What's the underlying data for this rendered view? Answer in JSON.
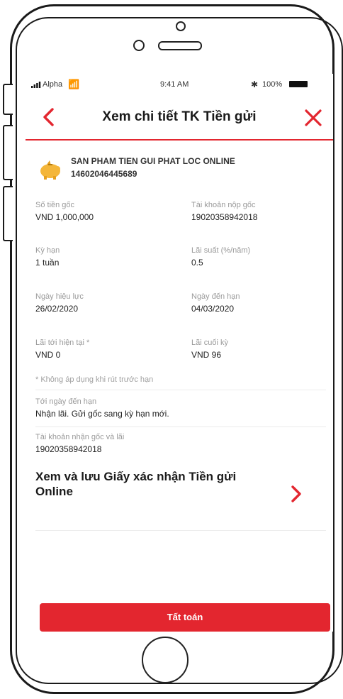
{
  "status_bar": {
    "carrier": "Alpha",
    "time": "9:41 AM",
    "battery": "100%"
  },
  "nav": {
    "title": "Xem chi tiết TK Tiền gửi"
  },
  "product": {
    "name": "SAN PHAM TIEN GUI PHAT LOC ONLINE",
    "number": "14602046445689"
  },
  "details": {
    "principal": {
      "label": "Số tiền gốc",
      "value": "VND 1,000,000"
    },
    "deposit_account": {
      "label": "Tài khoản nộp gốc",
      "value": "19020358942018"
    },
    "term": {
      "label": "Kỳ hạn",
      "value": "1 tuần"
    },
    "rate": {
      "label": "Lãi suất (%/năm)",
      "value": "0.5"
    },
    "effective_date": {
      "label": "Ngày hiệu lực",
      "value": "26/02/2020"
    },
    "maturity_date": {
      "label": "Ngày đến hạn",
      "value": "04/03/2020"
    },
    "current_interest": {
      "label": "Lãi tới hiện tại *",
      "value": "VND 0"
    },
    "final_interest": {
      "label": "Lãi cuối kỳ",
      "value": "VND 96"
    },
    "note": "* Không áp dụng khi rút trước hạn",
    "on_maturity": {
      "label": "Tới ngày đến hạn",
      "value": "Nhận lãi. Gửi gốc sang kỳ hạn mới."
    },
    "receiving_account": {
      "label": "Tài khoản nhận gốc và lãi",
      "value": "19020358942018"
    }
  },
  "certificate_link": {
    "label": "Xem và lưu Giấy xác nhận Tiền gửi Online"
  },
  "settle_button": {
    "label": "Tất toán"
  },
  "colors": {
    "accent": "#e3262f",
    "label": "#9a9a9a",
    "text": "#222222"
  },
  "icons": {
    "back": "chevron-left-icon",
    "close": "close-icon",
    "product": "piggy-bank-icon",
    "link": "chevron-right-icon"
  }
}
